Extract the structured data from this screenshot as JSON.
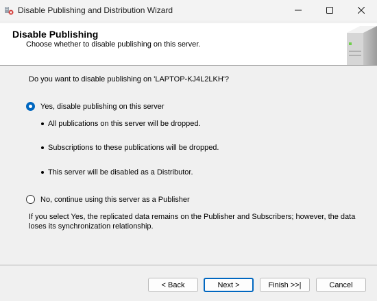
{
  "window": {
    "title": "Disable Publishing and Distribution Wizard",
    "controls": [
      "minimize",
      "maximize",
      "close"
    ]
  },
  "header": {
    "title": "Disable Publishing",
    "subtitle": "Choose whether to disable publishing on this server."
  },
  "body": {
    "question": "Do you want to disable publishing on 'LAPTOP-KJ4L2LKH'?",
    "option_yes": {
      "label": "Yes, disable publishing on this server",
      "selected": true,
      "bullets": [
        "All publications on this server will be dropped.",
        "Subscriptions to these publications will be dropped.",
        "This server will be disabled as a Distributor."
      ]
    },
    "option_no": {
      "label": "No, continue using this server as a Publisher",
      "selected": false
    },
    "note": "If you select Yes, the replicated data remains on the Publisher and Subscribers; however, the data loses its synchronization relationship."
  },
  "footer": {
    "back_label": "< Back",
    "next_label": "Next >",
    "finish_label": "Finish >>|",
    "cancel_label": "Cancel"
  },
  "colors": {
    "accent": "#0067c0",
    "titlebar_bg": "#f3f3f3",
    "header_bg": "#ffffff",
    "window_bg": "#f0f0f0"
  }
}
